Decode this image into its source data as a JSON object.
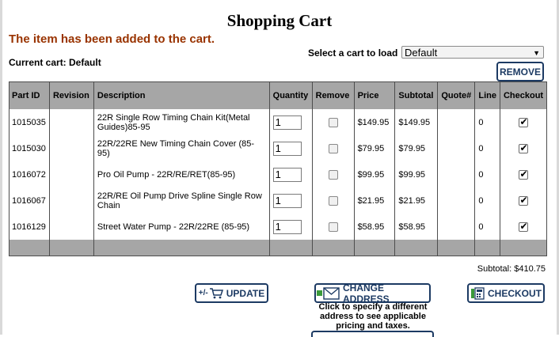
{
  "page": {
    "title": "Shopping Cart"
  },
  "message": "The item has been added to the cart.",
  "current_cart": "Current cart: Default",
  "cart_select": {
    "label": "Select a cart to load",
    "value": "Default"
  },
  "buttons": {
    "remove": "REMOVE",
    "update": "UPDATE",
    "update_prefix": "+/-",
    "change_address": "CHANGE ADDRESS",
    "checkout": "CHECKOUT"
  },
  "table": {
    "headers": [
      "Part ID",
      "Revision",
      "Description",
      "Quantity",
      "Remove",
      "Price",
      "Subtotal",
      "Quote#",
      "Line",
      "Checkout"
    ],
    "rows": [
      {
        "part_id": "1015035",
        "revision": "",
        "description": "22R Single Row Timing Chain Kit(Metal Guides)85-95",
        "quantity": "1",
        "remove": false,
        "price": "$149.95",
        "subtotal": "$149.95",
        "quote": "",
        "line": "0",
        "checkout": true
      },
      {
        "part_id": "1015030",
        "revision": "",
        "description": "22R/22RE New Timing Chain Cover (85-95)",
        "quantity": "1",
        "remove": false,
        "price": "$79.95",
        "subtotal": "$79.95",
        "quote": "",
        "line": "0",
        "checkout": true
      },
      {
        "part_id": "1016072",
        "revision": "",
        "description": "Pro Oil Pump - 22R/RE/RET(85-95)",
        "quantity": "1",
        "remove": false,
        "price": "$99.95",
        "subtotal": "$99.95",
        "quote": "",
        "line": "0",
        "checkout": true
      },
      {
        "part_id": "1016067",
        "revision": "",
        "description": "22R/RE Oil Pump Drive Spline Single Row Chain",
        "quantity": "1",
        "remove": false,
        "price": "$21.95",
        "subtotal": "$21.95",
        "quote": "",
        "line": "0",
        "checkout": true
      },
      {
        "part_id": "1016129",
        "revision": "",
        "description": "Street Water Pump - 22R/22RE (85-95)",
        "quantity": "1",
        "remove": false,
        "price": "$58.95",
        "subtotal": "$58.95",
        "quote": "",
        "line": "0",
        "checkout": true
      }
    ]
  },
  "subtotal": "Subtotal: $410.75",
  "change_address_hint": "Click to specify a different address to see applicable pricing and taxes.",
  "icons": {
    "update": "cart-icon",
    "change_address": "envelope-icon",
    "checkout": "calculator-icon"
  },
  "colors": {
    "message": "#993300",
    "button_border": "#1c3a63",
    "table_header": "#a6a6a6"
  }
}
